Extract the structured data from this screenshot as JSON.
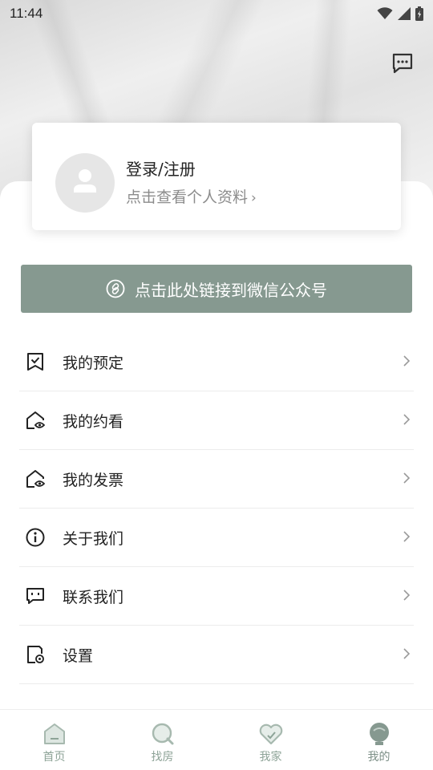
{
  "status_bar": {
    "time": "11:44"
  },
  "profile": {
    "title": "登录/注册",
    "subtitle": "点击查看个人资料",
    "chevron": "›"
  },
  "wechat_link": {
    "label": "点击此处链接到微信公众号"
  },
  "menu": [
    {
      "label": "我的预定",
      "icon": "bookmark-check-icon"
    },
    {
      "label": "我的约看",
      "icon": "house-eye-icon"
    },
    {
      "label": "我的发票",
      "icon": "house-eye-icon"
    },
    {
      "label": "关于我们",
      "icon": "info-icon"
    },
    {
      "label": "联系我们",
      "icon": "message-icon"
    },
    {
      "label": "设置",
      "icon": "settings-doc-icon"
    }
  ],
  "tabbar": [
    {
      "label": "首页",
      "icon": "home-icon",
      "active": false
    },
    {
      "label": "找房",
      "icon": "search-icon",
      "active": false
    },
    {
      "label": "我家",
      "icon": "heart-icon",
      "active": false
    },
    {
      "label": "我的",
      "icon": "profile-icon",
      "active": true
    }
  ],
  "colors": {
    "accent": "#869990",
    "tab_inactive": "#8da397",
    "background": "#ffffff"
  }
}
